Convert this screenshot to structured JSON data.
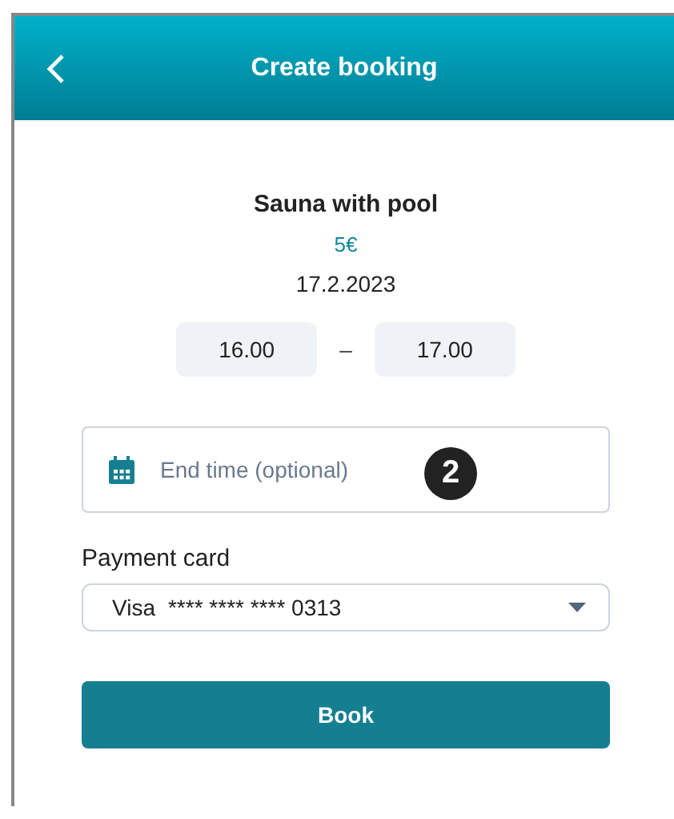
{
  "header": {
    "title": "Create booking"
  },
  "service": {
    "name": "Sauna with pool",
    "price": "5€",
    "date": "17.2.2023"
  },
  "time_range": {
    "start": "16.00",
    "separator": "–",
    "end": "17.00"
  },
  "end_time_field": {
    "placeholder": "End time (optional)",
    "badge": "2"
  },
  "payment": {
    "label": "Payment card",
    "brand": "Visa",
    "number": "**** **** **** 0313"
  },
  "book_button": {
    "label": "Book"
  }
}
